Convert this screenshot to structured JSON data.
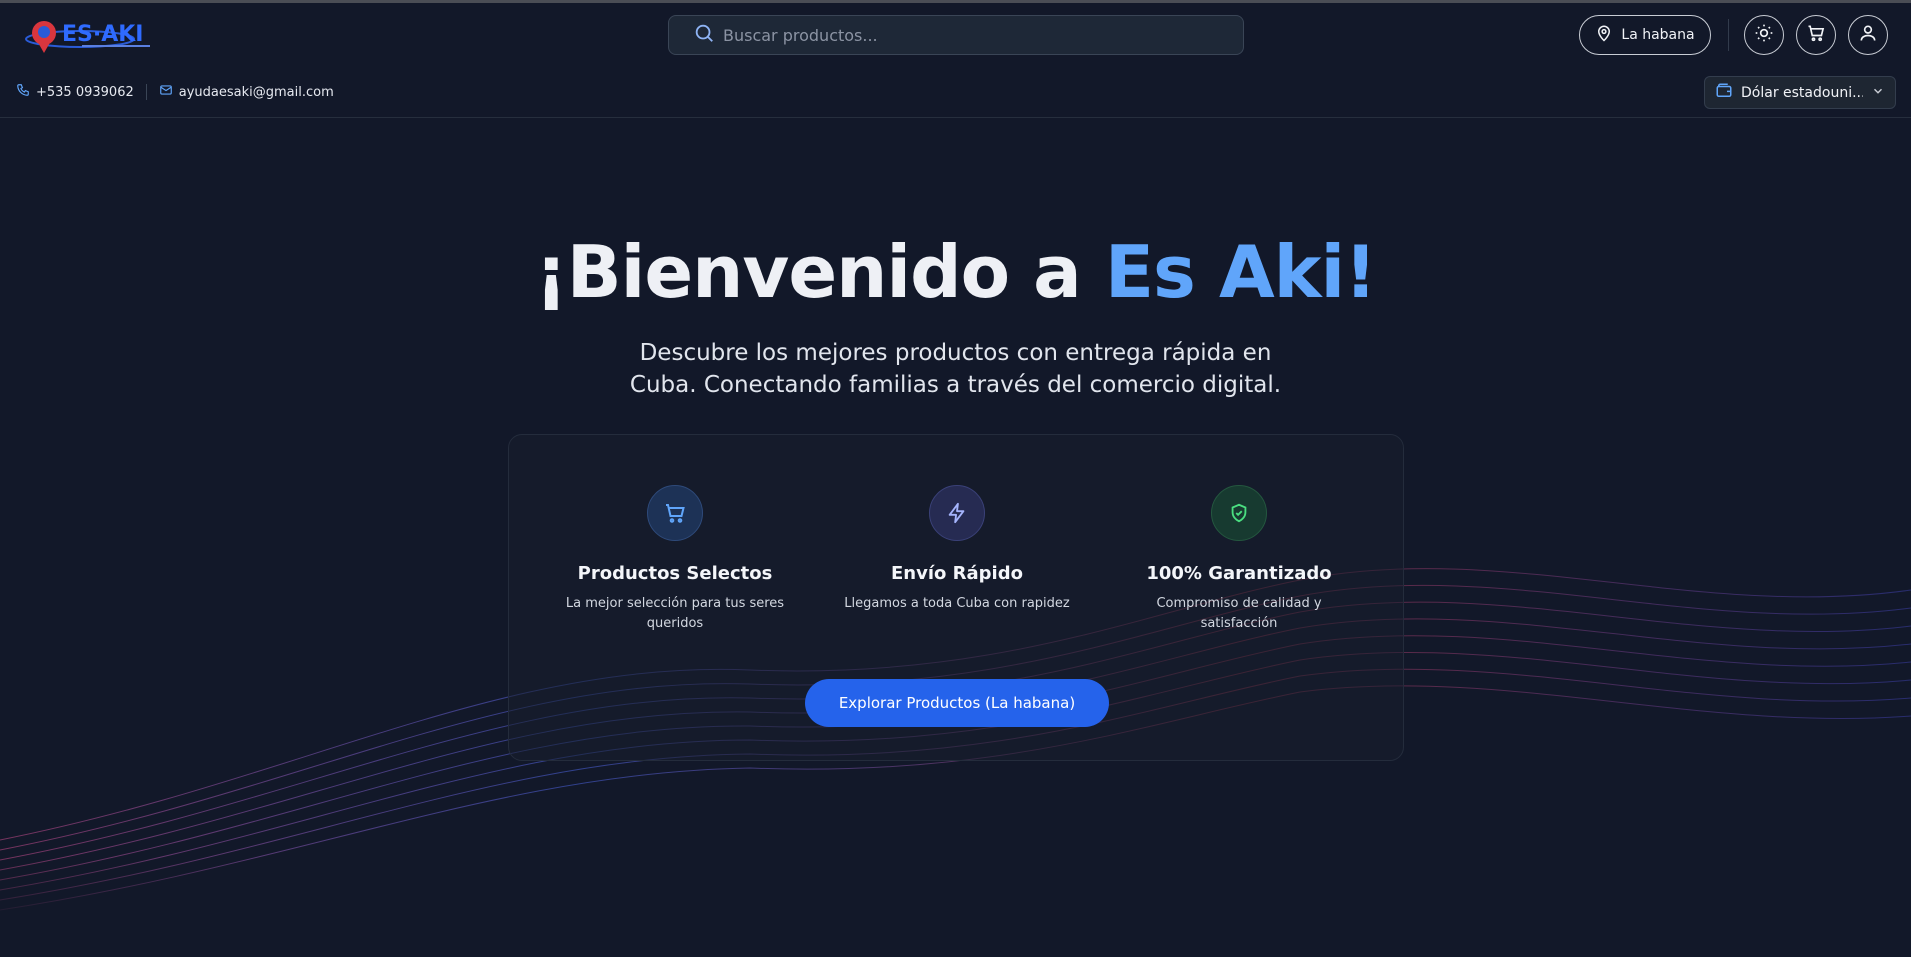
{
  "header": {
    "logo_text": "ES·AKI",
    "search_placeholder": "Buscar productos...",
    "location_label": "La habana"
  },
  "contact": {
    "phone": "+535 0939062",
    "email": "ayudaesaki@gmail.com"
  },
  "currency": {
    "selected": "Dólar estadouni..."
  },
  "hero": {
    "title_prefix": "¡Bienvenido a ",
    "title_accent": "Es Aki!",
    "subtitle": "Descubre los mejores productos con entrega rápida en Cuba. Conectando familias a través del comercio digital."
  },
  "features": [
    {
      "icon": "cart-icon",
      "title": "Productos Selectos",
      "desc": "La mejor selección para tus seres queridos",
      "color": "#60a5fa"
    },
    {
      "icon": "lightning-icon",
      "title": "Envío Rápido",
      "desc": "Llegamos a toda Cuba con rapidez",
      "color": "#a5b4fc"
    },
    {
      "icon": "shield-check-icon",
      "title": "100% Garantizado",
      "desc": "Compromiso de calidad y satisfacción",
      "color": "#4ade80"
    }
  ],
  "cta": {
    "label": "Explorar Productos (La habana)"
  },
  "colors": {
    "accent": "#60a5fa",
    "button": "#2563eb",
    "background": "#121829"
  }
}
